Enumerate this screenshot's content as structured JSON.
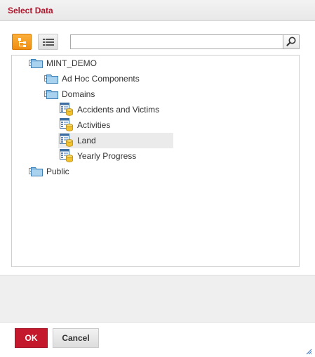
{
  "dialog": {
    "title": "Select Data"
  },
  "toolbar": {
    "tree_view_icon": "tree-view-icon",
    "list_view_icon": "list-view-icon",
    "search_value": "",
    "search_icon": "magnifier-icon"
  },
  "tree": {
    "nodes": [
      {
        "label": "MINT_DEMO",
        "type": "folder",
        "expander": "minus",
        "level": 0,
        "selected": false
      },
      {
        "label": "Ad Hoc Components",
        "type": "folder",
        "expander": "plus",
        "level": 1,
        "selected": false
      },
      {
        "label": "Domains",
        "type": "folder",
        "expander": "minus",
        "level": 1,
        "selected": false
      },
      {
        "label": "Accidents and Victims",
        "type": "domain",
        "expander": "none",
        "level": 2,
        "selected": false
      },
      {
        "label": "Activities",
        "type": "domain",
        "expander": "none",
        "level": 2,
        "selected": false
      },
      {
        "label": "Land",
        "type": "domain",
        "expander": "none",
        "level": 2,
        "selected": true
      },
      {
        "label": "Yearly Progress",
        "type": "domain",
        "expander": "none",
        "level": 2,
        "selected": false
      },
      {
        "label": "Public",
        "type": "folder",
        "expander": "plus",
        "level": 0,
        "selected": false
      }
    ]
  },
  "buttons": {
    "ok_label": "OK",
    "cancel_label": "Cancel"
  },
  "colors": {
    "accent": "#c4182d",
    "title": "#b0152c",
    "tree_toggle_active": "#f39a1d",
    "selection": "#ebebeb"
  }
}
